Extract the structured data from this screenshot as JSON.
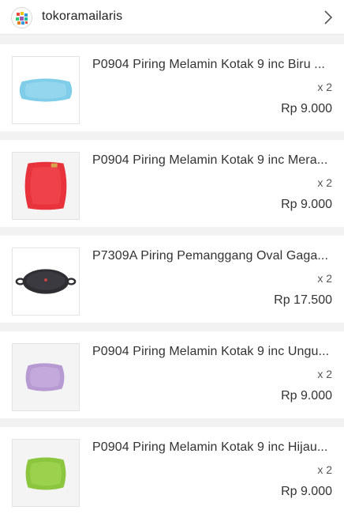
{
  "shop": {
    "name": "tokoramailaris",
    "logo_icon": "shop-logo-icon",
    "chevron_icon": "chevron-right-icon"
  },
  "items": [
    {
      "title": "P0904 Piring Melamin Kotak 9 inc Biru ...",
      "qty": "x 2",
      "price": "Rp 9.000",
      "image_icon": "blue-square-plate-image",
      "color": "#7fcde9"
    },
    {
      "title": "P0904 Piring Melamin Kotak 9 inc Mera...",
      "qty": "x 2",
      "price": "Rp 9.000",
      "image_icon": "red-square-plate-image",
      "color": "#e8323c"
    },
    {
      "title": "P7309A Piring Pemanggang Oval Gaga...",
      "qty": "x 2",
      "price": "Rp 17.500",
      "image_icon": "black-oval-grill-pan-image",
      "color": "#2e2e33"
    },
    {
      "title": "P0904 Piring Melamin Kotak 9 inc Ungu...",
      "qty": "x 2",
      "price": "Rp 9.000",
      "image_icon": "purple-square-plate-image",
      "color": "#b79ad2"
    },
    {
      "title": "P0904 Piring Melamin Kotak 9 inc Hijau...",
      "qty": "x 2",
      "price": "Rp 9.000",
      "image_icon": "green-square-plate-image",
      "color": "#8cc63f"
    }
  ]
}
